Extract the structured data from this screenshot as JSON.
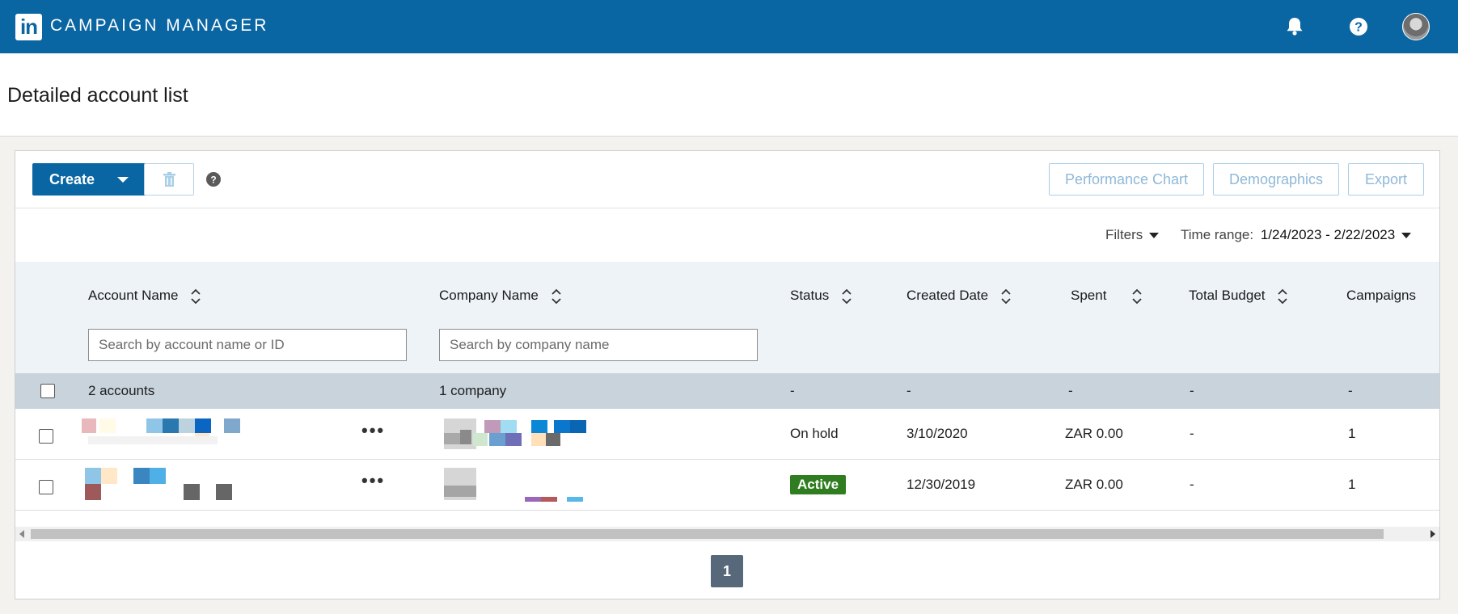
{
  "header": {
    "logo_text": "in",
    "app_title": "CAMPAIGN MANAGER",
    "notifications_icon": "bell-icon",
    "help_icon": "question-circle-icon",
    "avatar_icon": "user-avatar"
  },
  "page": {
    "title": "Detailed account list"
  },
  "toolbar": {
    "create_label": "Create",
    "delete_icon": "trash-icon",
    "help_icon": "question-circle-icon",
    "performance_chart_label": "Performance Chart",
    "demographics_label": "Demographics",
    "export_label": "Export"
  },
  "filters": {
    "filters_label": "Filters",
    "time_range_label": "Time range:",
    "time_range_value": "1/24/2023 - 2/22/2023"
  },
  "table": {
    "columns": {
      "account_name": "Account Name",
      "company_name": "Company Name",
      "status": "Status",
      "created_date": "Created Date",
      "spent": "Spent",
      "total_budget": "Total Budget",
      "campaigns": "Campaigns"
    },
    "search_account_placeholder": "Search by account name or ID",
    "search_company_placeholder": "Search by company name",
    "summary": {
      "accounts": "2 accounts",
      "companies": "1 company",
      "status": "-",
      "created_date": "-",
      "spent": "-",
      "total_budget": "-",
      "campaigns": "-"
    },
    "rows": [
      {
        "status": "On hold",
        "created_date": "3/10/2020",
        "spent": "ZAR 0.00",
        "total_budget": "-",
        "campaigns": "1"
      },
      {
        "status": "Active",
        "created_date": "12/30/2019",
        "spent": "ZAR 0.00",
        "total_budget": "-",
        "campaigns": "1"
      }
    ]
  },
  "pagination": {
    "current_page": "1"
  },
  "colors": {
    "brand": "#0a66a2",
    "active_badge": "#2f7d20",
    "summary_bg": "#c8d3dc"
  }
}
